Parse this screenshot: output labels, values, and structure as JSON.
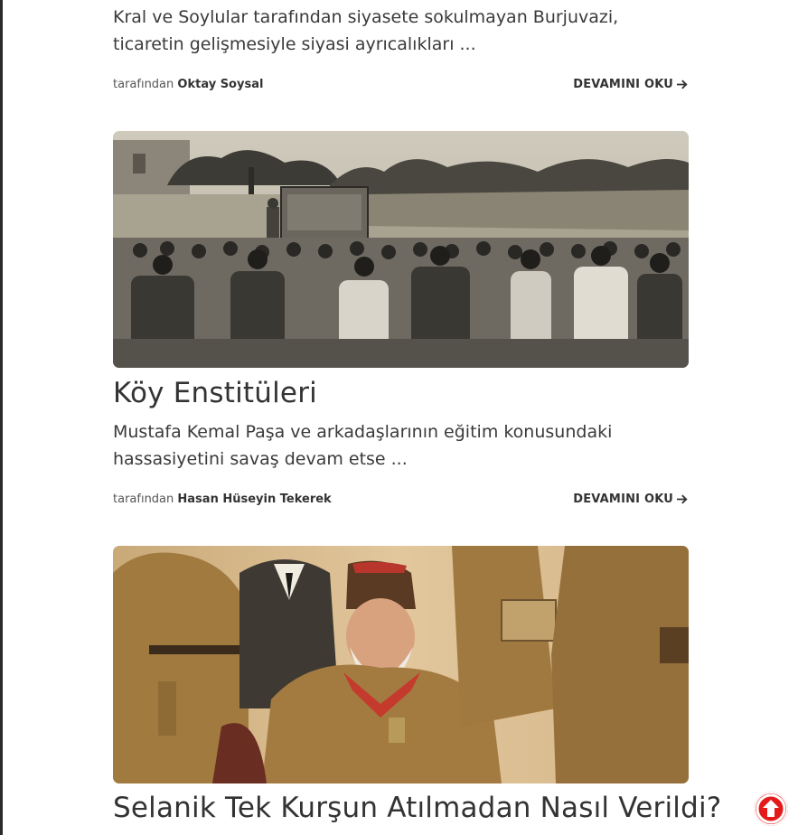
{
  "posts": [
    {
      "excerpt": "Kral ve Soylular tarafından siyasete sokulmayan Burjuvazi, ticaretin gelişmesiyle siyasi ayrıcalıkları ...",
      "by_label": "tarafından",
      "author": "Oktay Soysal",
      "read_more": "DEVAMINI OKU"
    },
    {
      "title": "Köy Enstitüleri",
      "excerpt": "Mustafa Kemal Paşa ve arkadaşlarının eğitim konusundaki hassasiyetini savaş devam etse ...",
      "by_label": "tarafından",
      "author": "Hasan Hüseyin Tekerek",
      "read_more": "DEVAMINI OKU"
    },
    {
      "title": "Selanik Tek Kurşun Atılmadan Nasıl Verildi?"
    }
  ],
  "icons": {
    "read_more_arrow": "arrow-right-icon",
    "scroll_top": "arrow-up-circle-icon"
  },
  "colors": {
    "scroll_top_bg": "#e41b1b",
    "text": "#333333"
  }
}
